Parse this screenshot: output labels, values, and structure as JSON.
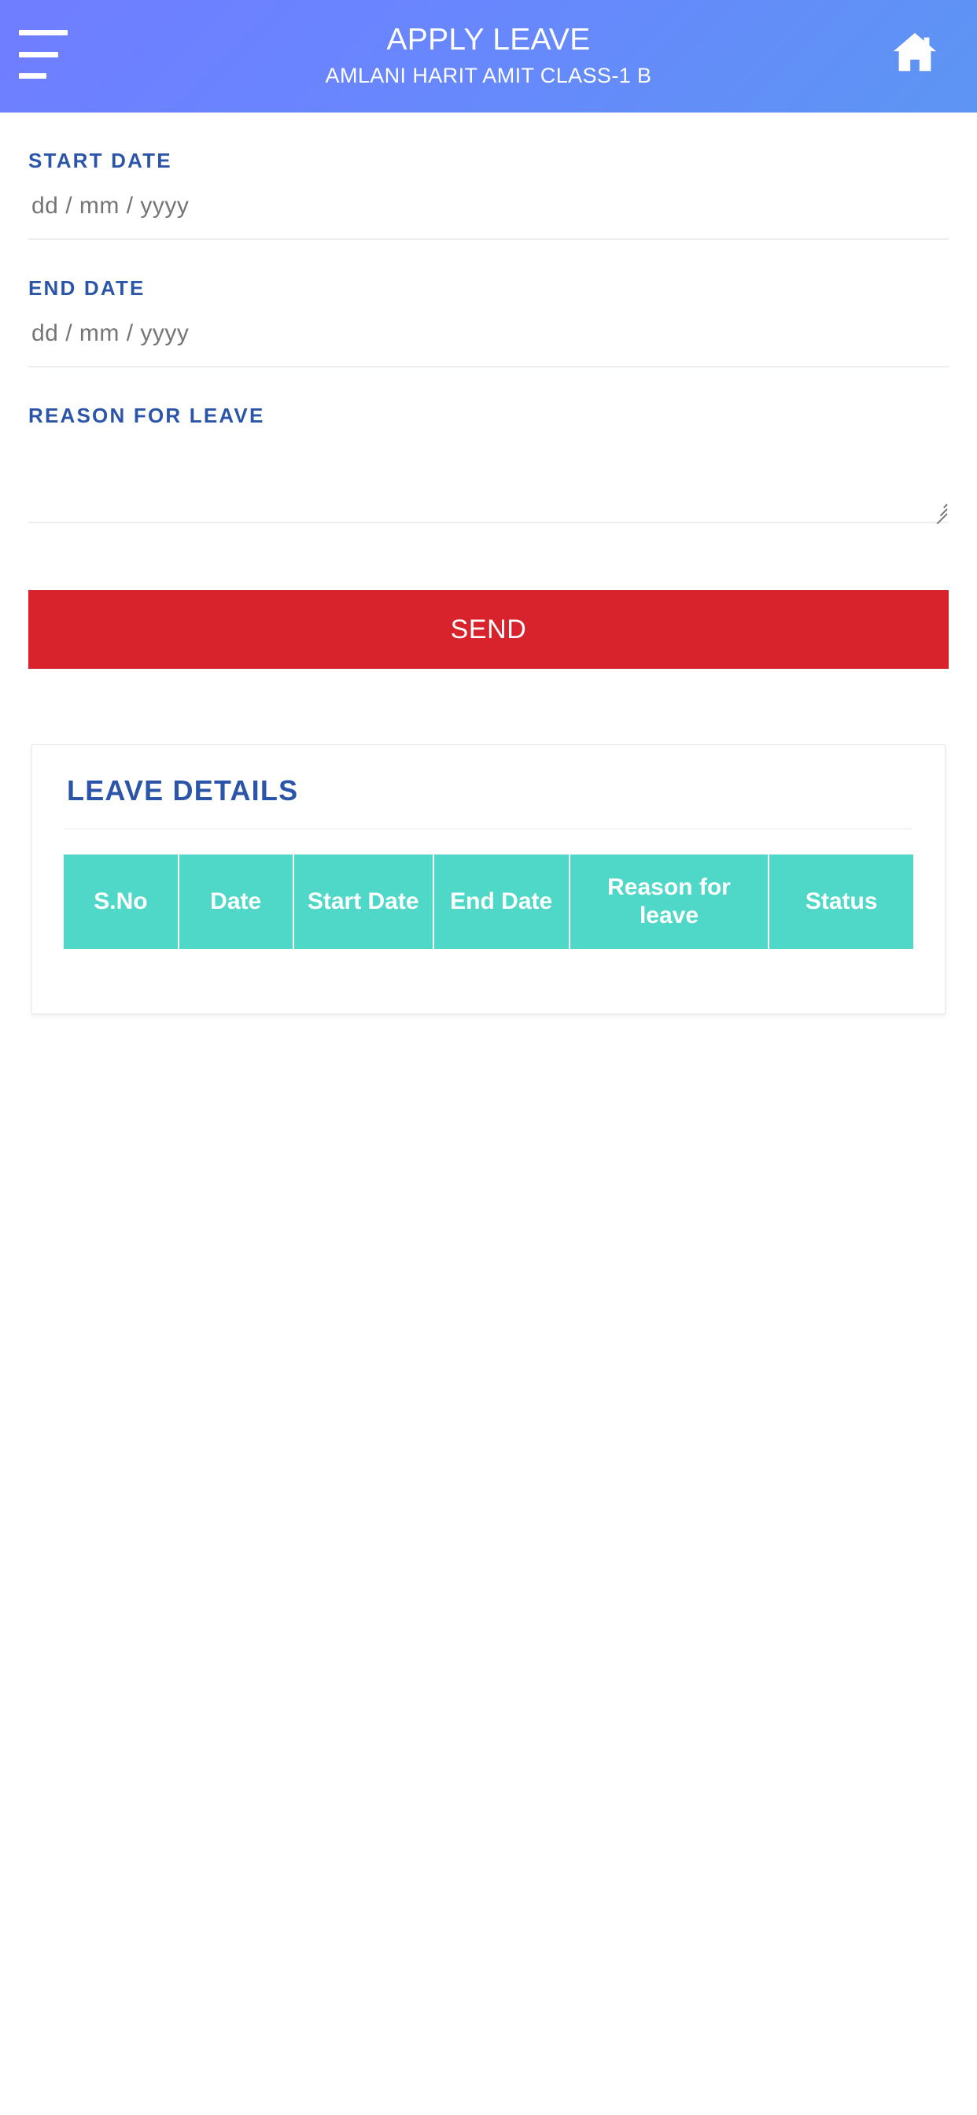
{
  "header": {
    "title": "APPLY LEAVE",
    "subtitle": "AMLANI HARIT AMIT CLASS-1 B",
    "menu_icon": "hamburger-menu-icon",
    "home_icon": "home-icon",
    "gradient_start": "#6f7dff",
    "gradient_end": "#5d95f3"
  },
  "form": {
    "start_date": {
      "label": "START DATE",
      "value": "",
      "placeholder": "dd / mm / yyyy"
    },
    "end_date": {
      "label": "END DATE",
      "value": "",
      "placeholder": "dd / mm / yyyy"
    },
    "reason": {
      "label": "REASON FOR LEAVE",
      "value": "",
      "placeholder": ""
    },
    "submit": {
      "label": "SEND",
      "color": "#d9232c"
    },
    "label_color": "#2b55a8"
  },
  "leave_details": {
    "title": "LEAVE DETAILS",
    "header_color": "#4fd8c8",
    "columns": [
      {
        "key": "sno",
        "label": "S.No"
      },
      {
        "key": "date",
        "label": "Date"
      },
      {
        "key": "start_date",
        "label": "Start Date"
      },
      {
        "key": "end_date",
        "label": "End Date"
      },
      {
        "key": "reason",
        "label": "Reason for leave"
      },
      {
        "key": "status",
        "label": "Status"
      }
    ],
    "rows": []
  }
}
